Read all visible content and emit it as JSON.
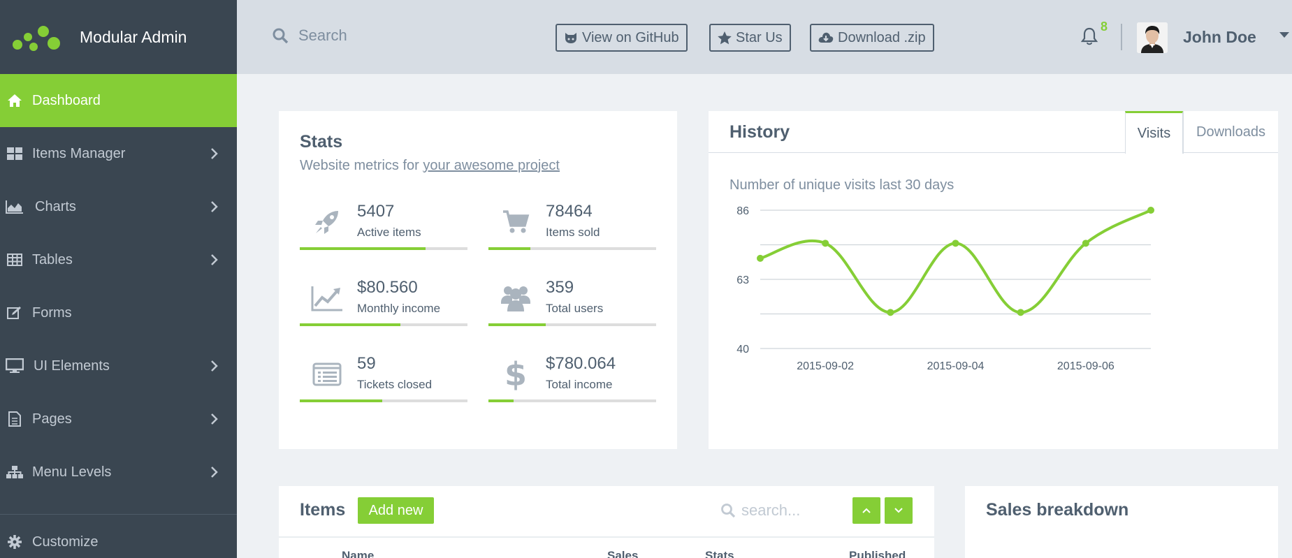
{
  "brand": {
    "title": "Modular Admin"
  },
  "sidebar": {
    "items": [
      {
        "label": "Dashboard",
        "icon": "home-icon",
        "active": true,
        "has_submenu": false
      },
      {
        "label": "Items Manager",
        "icon": "grid-icon",
        "active": false,
        "has_submenu": true
      },
      {
        "label": "Charts",
        "icon": "area-chart-icon",
        "active": false,
        "has_submenu": true
      },
      {
        "label": "Tables",
        "icon": "table-icon",
        "active": false,
        "has_submenu": true
      },
      {
        "label": "Forms",
        "icon": "edit-icon",
        "active": false,
        "has_submenu": false
      },
      {
        "label": "UI Elements",
        "icon": "desktop-icon",
        "active": false,
        "has_submenu": true
      },
      {
        "label": "Pages",
        "icon": "file-icon",
        "active": false,
        "has_submenu": true
      },
      {
        "label": "Menu Levels",
        "icon": "sitemap-icon",
        "active": false,
        "has_submenu": true
      }
    ],
    "customize": {
      "label": "Customize",
      "icon": "gear-icon"
    }
  },
  "header": {
    "search_placeholder": "Search",
    "buttons": {
      "github": "View on GitHub",
      "star": "Star Us",
      "download": "Download .zip"
    },
    "notifications_count": "8",
    "user_name": "John Doe"
  },
  "stats": {
    "title": "Stats",
    "subtitle_prefix": "Website metrics for ",
    "subtitle_link": "your awesome project",
    "items": [
      {
        "value": "5407",
        "label": "Active items",
        "icon": "rocket-icon",
        "progress": 0.75
      },
      {
        "value": "78464",
        "label": "Items sold",
        "icon": "cart-icon",
        "progress": 0.25
      },
      {
        "value": "$80.560",
        "label": "Monthly income",
        "icon": "line-chart-icon",
        "progress": 0.6
      },
      {
        "value": "359",
        "label": "Total users",
        "icon": "users-icon",
        "progress": 0.34
      },
      {
        "value": "59",
        "label": "Tickets closed",
        "icon": "list-alt-icon",
        "progress": 0.49
      },
      {
        "value": "$780.064",
        "label": "Total income",
        "icon": "dollar-icon",
        "progress": 0.15
      }
    ]
  },
  "history": {
    "title": "History",
    "tabs": [
      {
        "label": "Visits",
        "active": true
      },
      {
        "label": "Downloads",
        "active": false
      }
    ],
    "caption": "Number of unique visits last 30 days"
  },
  "chart_data": {
    "type": "line",
    "x": [
      "2015-09-01",
      "2015-09-02",
      "2015-09-03",
      "2015-09-04",
      "2015-09-05",
      "2015-09-06",
      "2015-09-07"
    ],
    "series": [
      {
        "values": [
          70,
          75,
          52,
          75,
          52,
          75,
          86
        ]
      }
    ],
    "xticks": [
      "2015-09-02",
      "2015-09-04",
      "2015-09-06"
    ],
    "yticks": [
      40,
      63,
      86
    ],
    "ylim": [
      40,
      86
    ],
    "grid": true,
    "color": "#85ce36"
  },
  "items": {
    "title": "Items",
    "add_label": "Add new",
    "search_placeholder": "search...",
    "columns": [
      "Name",
      "Sales",
      "Stats",
      "Published"
    ]
  },
  "sales": {
    "title": "Sales breakdown"
  },
  "colors": {
    "accent": "#85ce36",
    "sidebar": "#3a4651",
    "header": "#d7dde4"
  }
}
